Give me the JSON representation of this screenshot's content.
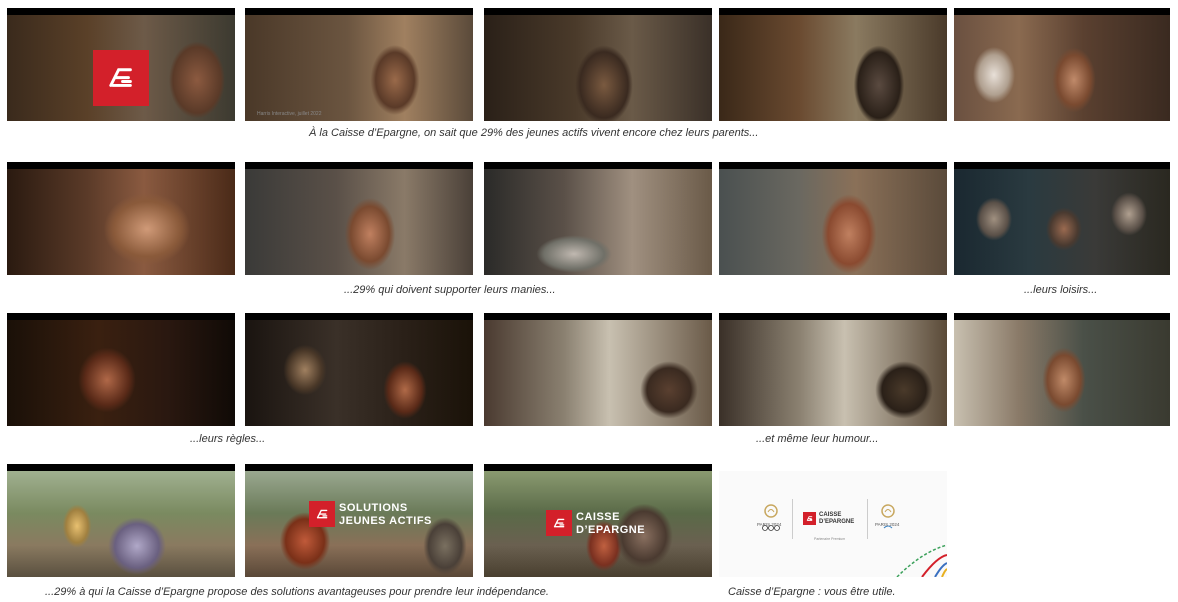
{
  "captions": {
    "row1": "À la Caisse d’Epargne, on sait que 29% des jeunes actifs vivent encore chez leurs parents...",
    "row2a": "...29% qui doivent supporter leurs manies...",
    "row2b": "...leurs loisirs...",
    "row3a": "...leurs règles...",
    "row3b": "...et même leur humour...",
    "row4a": "...29% à qui la Caisse d’Epargne propose des solutions avantageuses pour prendre leur indépendance.",
    "row4b": "Caisse d’Epargne : vous être utile."
  },
  "frame_text": {
    "disclaimer": "Harris Interactive, juillet 2022",
    "solutions_line1": "SOLUTIONS",
    "solutions_line2": "JEUNES ACTIFS",
    "brand_line1": "CAISSE",
    "brand_line2": "D’EPARGNE"
  },
  "endcard": {
    "left_logo_text": "PARIS 2024",
    "brand_line1": "CAISSE",
    "brand_line2": "D’EPARGNE",
    "right_logo_text": "PARIS 2024",
    "subtext": "Partenaire Premium"
  },
  "colors": {
    "brand_red": "#d3202a"
  }
}
